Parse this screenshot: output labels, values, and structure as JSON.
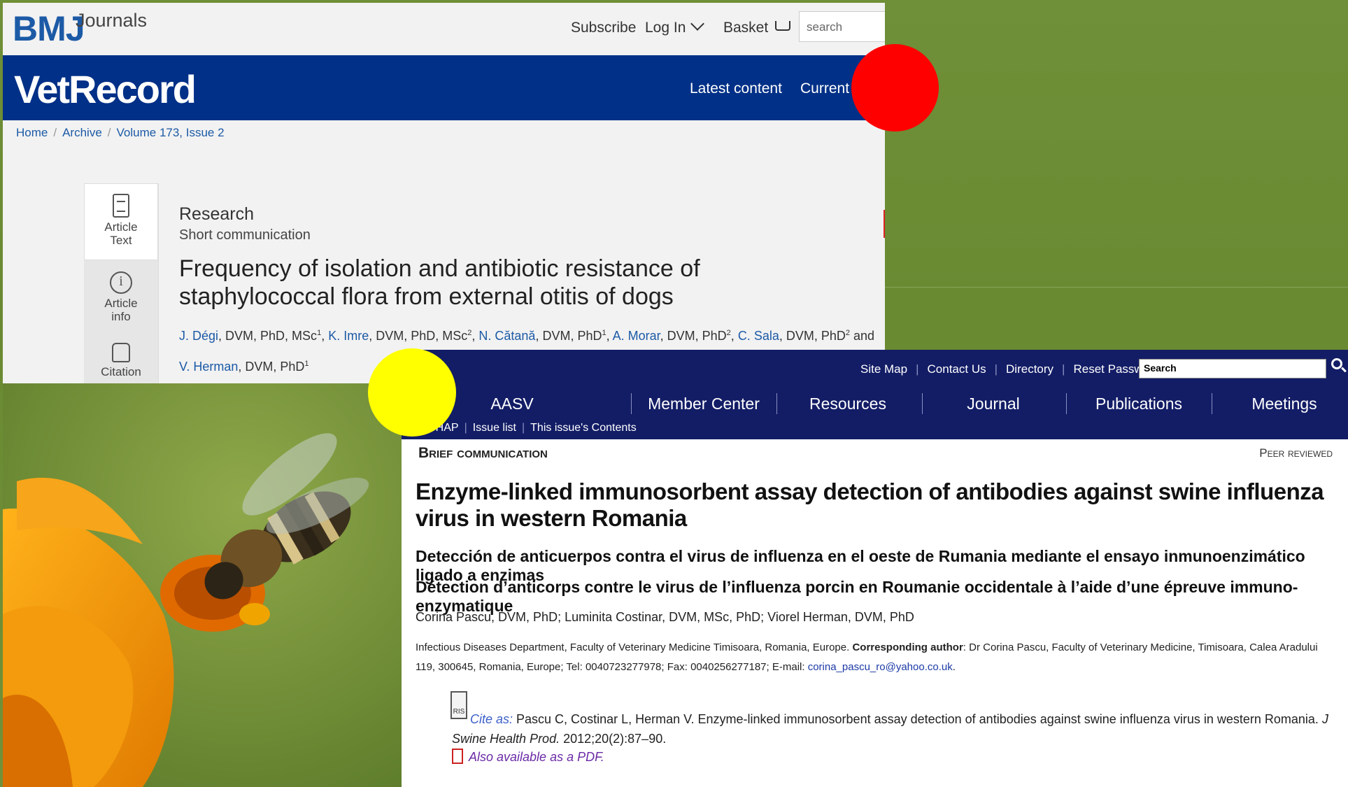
{
  "bmj": {
    "logo": "BMJ",
    "logo_sub": "Journals",
    "nav_subscribe": "Subscribe",
    "nav_login": "Log In",
    "nav_basket": "Basket",
    "search_placeholder": "search",
    "journal_title": "VetRecord",
    "nav_latest": "Latest content",
    "nav_current": "Current is",
    "breadcrumbs": [
      "Home",
      "Archive",
      "Volume 173, Issue 2"
    ],
    "sidebar": [
      {
        "label_1": "Article",
        "label_2": "Text"
      },
      {
        "label_1": "Article",
        "label_2": "info"
      },
      {
        "label_1": "Citation",
        "label_2": ""
      }
    ],
    "article_type": "Research",
    "article_subtype": "Short communication",
    "article_title": "Frequency of isolation and antibiotic resistance of staphylococcal flora from external otitis of dogs",
    "authors": [
      {
        "name": "J. Dégi",
        "creds": ", DVM, PhD, MSc",
        "sup": "1"
      },
      {
        "name": "K. Imre",
        "creds": ", DVM, PhD, MSc",
        "sup": "2"
      },
      {
        "name": "N. Cătană",
        "creds": ", DVM, PhD",
        "sup": "1"
      },
      {
        "name": "A. Morar",
        "creds": ", DVM, PhD",
        "sup": "2"
      },
      {
        "name": "C. Sala",
        "creds": ", DVM, PhD",
        "sup": "2"
      },
      {
        "name": "V. Herman",
        "creds": ", DVM, PhD",
        "sup": "1"
      }
    ],
    "authors_and": " and "
  },
  "jshap": {
    "util_links": [
      "Site Map",
      "Contact Us",
      "Directory",
      "Reset Password"
    ],
    "search_placeholder": "Search",
    "main_nav": [
      "AASV",
      "Member Center",
      "Resources",
      "Journal",
      "Publications",
      "Meetings"
    ],
    "sub_nav": [
      "JSHAP",
      "Issue list",
      "This issue's Contents"
    ],
    "section": "Brief communication",
    "peer": "Peer reviewed",
    "title": "Enzyme-linked immunosorbent assay detection of antibodies against swine influenza virus in western Romania",
    "title_es": "Detección de anticuerpos contra el virus de influenza en el oeste de Rumania mediante el ensayo inmunoenzimático ligado a enzimas",
    "title_fr": "Détection d’anticorps contre le virus de l’influenza porcin en Roumanie occidentale à l’aide d’une épreuve immuno-enzymatique",
    "authors": "Corina Pascu, DVM, PhD; Luminita Costinar, DVM, MSc, PhD; Viorel Herman, DVM, PhD",
    "affiliation": "Infectious Diseases Department, Faculty of Veterinary Medicine Timisoara, Romania, Europe.",
    "corr_label": "Corresponding author",
    "corr_text": ": Dr Corina Pascu, Faculty of Veterinary Medicine, Timisoara, Calea Aradului 119, 300645, Romania, Europe; Tel: 0040723277978; Fax: 0040256277187; E-mail: ",
    "email": "corina_pascu_ro@yahoo.co.uk",
    "email_tail": ".",
    "cite_label": "Cite as:",
    "cite_text": " Pascu C, Costinar L, Herman V. Enzyme-linked immunosorbent assay detection of antibodies against swine influenza virus in western Romania. ",
    "cite_journal": "J Swine Health Prod.",
    "cite_tail": " 2012;20(2):87–90.",
    "pdf_label": "Also available as a PDF.",
    "ris_label": "RIS"
  },
  "colors": {
    "bmj_blue": "#1c5aa6",
    "vetrecord_bar": "#003087",
    "aasv_bar": "#131d66",
    "background_green": "#6b8c34",
    "red_marker": "#ff0000",
    "yellow_marker": "#ffff00"
  }
}
